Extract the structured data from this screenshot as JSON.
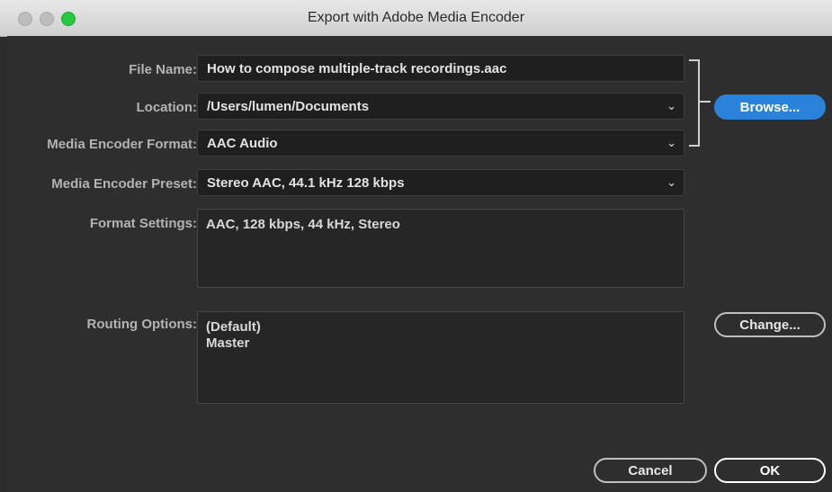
{
  "window": {
    "title": "Export with Adobe Media Encoder",
    "colors": {
      "titlebar": "#d6d6d6",
      "background": "#2e2e2e",
      "accent": "#2a83d8",
      "maximize": "#28c840"
    }
  },
  "form": {
    "file_name": {
      "label": "File Name:",
      "value": "How to compose multiple-track recordings.aac"
    },
    "location": {
      "label": "Location:",
      "value": "/Users/lumen/Documents"
    },
    "format": {
      "label": "Media Encoder Format:",
      "value": "AAC Audio"
    },
    "preset": {
      "label": "Media Encoder Preset:",
      "value": "Stereo AAC, 44.1 kHz 128 kbps"
    },
    "format_settings": {
      "label": "Format Settings:",
      "value": "AAC, 128 kbps, 44 kHz, Stereo"
    },
    "routing": {
      "label": "Routing Options:",
      "lines": [
        "(Default)",
        "Master"
      ]
    }
  },
  "buttons": {
    "browse": "Browse...",
    "change": "Change...",
    "cancel": "Cancel",
    "ok": "OK"
  },
  "icons": {
    "dropdown": "chevron-down-icon"
  }
}
